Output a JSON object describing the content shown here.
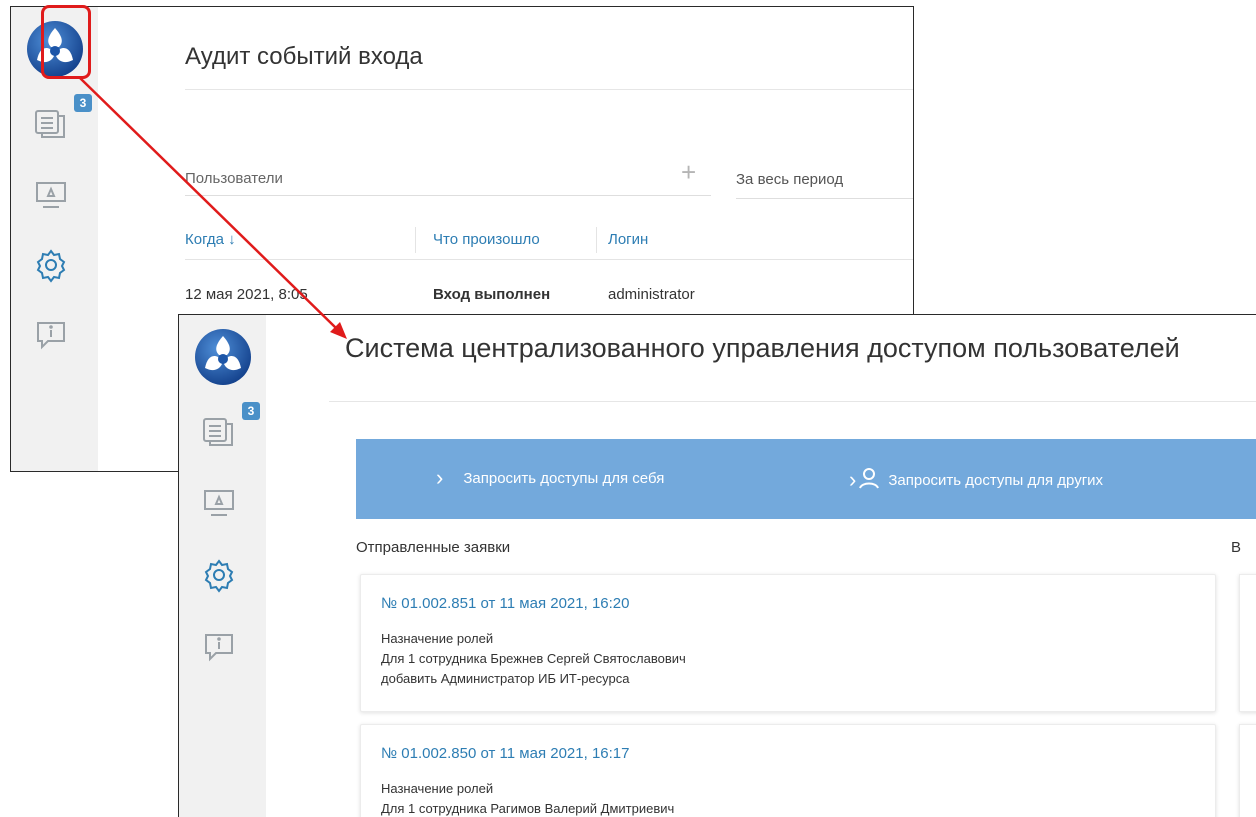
{
  "back_window": {
    "title": "Аудит событий входа",
    "badge_count": "3",
    "filter": {
      "users_placeholder": "Пользователи",
      "period_value": "За весь период"
    },
    "table": {
      "columns": [
        "Когда ↓",
        "Что произошло",
        "Логин"
      ],
      "rows": [
        {
          "when": "12 мая 2021, 8:05",
          "event": "Вход выполнен",
          "login": "administrator"
        }
      ]
    }
  },
  "front_window": {
    "title": "Система централизованного управления доступом пользователей",
    "badge_count": "3",
    "banner": {
      "request_self_label": "Запросить доступы для себя",
      "request_others_label": "Запросить доступы для других"
    },
    "sent_requests_label": "Отправленные заявки",
    "truncated_column_letter": "В",
    "cards": [
      {
        "link": "№ 01.002.851 от 11 мая 2021, 16:20",
        "lines": [
          "Назначение ролей",
          "Для 1 сотрудника Брежнев Сергей Святославович",
          "добавить Администратор ИБ ИТ-ресурса"
        ]
      },
      {
        "link": "№ 01.002.850 от 11 мая 2021, 16:17",
        "lines": [
          "Назначение ролей",
          "Для 1 сотрудника Рагимов Валерий Дмитриевич"
        ]
      }
    ]
  },
  "colors": {
    "accent_blue": "#2d7db3",
    "banner_blue": "#73a9dc",
    "badge_blue": "#4a90c8",
    "annotation_red": "#e01b1b",
    "sidebar_gray": "#f1f1f1",
    "icon_gray": "#9aa1a7"
  },
  "icons": [
    "logo-icon",
    "messages-icon",
    "monitor-icon",
    "settings-icon",
    "info-chat-icon",
    "plus-icon",
    "chevron-right-icon",
    "user-icon",
    "sort-down-icon"
  ]
}
